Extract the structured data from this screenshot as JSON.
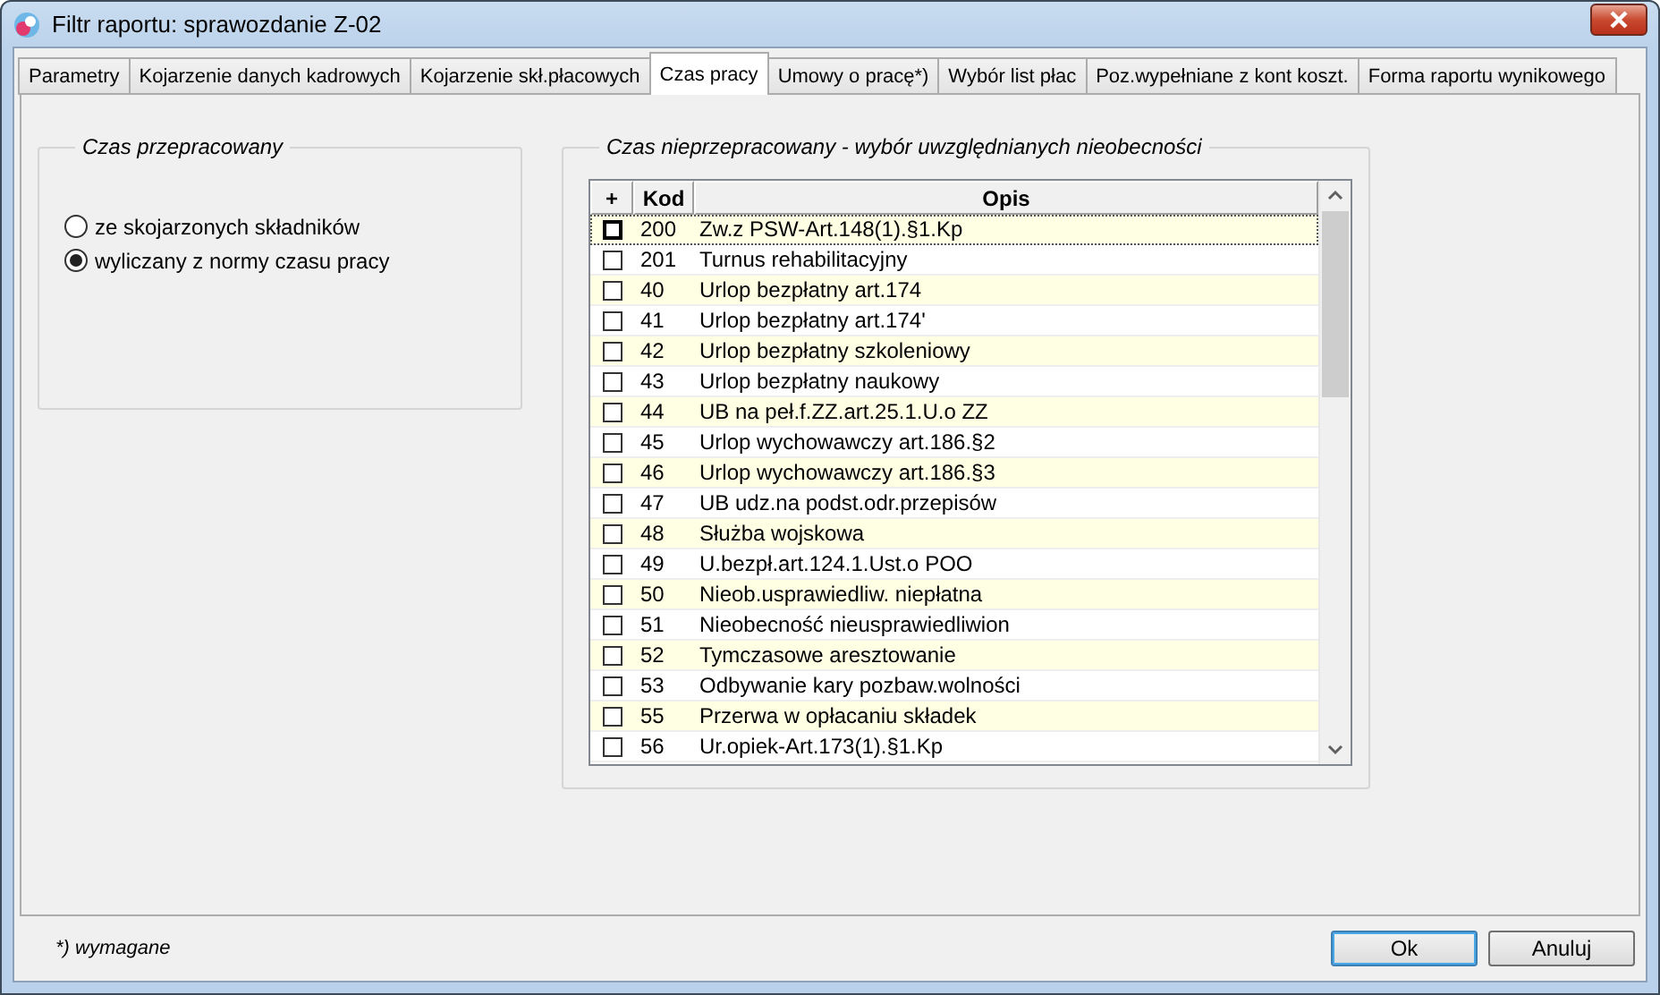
{
  "window": {
    "title": "Filtr raportu: sprawozdanie Z-02"
  },
  "tabs": [
    {
      "label": "Parametry",
      "selected": false
    },
    {
      "label": "Kojarzenie danych kadrowych",
      "selected": false
    },
    {
      "label": "Kojarzenie skł.płacowych",
      "selected": false
    },
    {
      "label": "Czas pracy",
      "selected": true
    },
    {
      "label": "Umowy o pracę*)",
      "selected": false
    },
    {
      "label": "Wybór list płac",
      "selected": false
    },
    {
      "label": "Poz.wypełniane z kont koszt.",
      "selected": false
    },
    {
      "label": "Forma raportu wynikowego",
      "selected": false
    }
  ],
  "worked_time": {
    "title": "Czas przepracowany",
    "options": [
      {
        "label": "ze skojarzonych składników",
        "selected": false
      },
      {
        "label": "wyliczany z normy czasu pracy",
        "selected": true
      }
    ]
  },
  "unworked_time": {
    "title": "Czas nieprzepracowany - wybór uwzględnianych nieobecności",
    "table": {
      "columns": [
        "+",
        "Kod",
        "Opis"
      ],
      "rows": [
        {
          "code": "200",
          "description": "Zw.z PSW-Art.148(1).§1.Kp",
          "checked": false,
          "focused": true
        },
        {
          "code": "201",
          "description": "Turnus rehabilitacyjny",
          "checked": false,
          "focused": false
        },
        {
          "code": "40",
          "description": "Urlop bezpłatny art.174",
          "checked": false,
          "focused": false
        },
        {
          "code": "41",
          "description": "Urlop bezpłatny art.174'",
          "checked": false,
          "focused": false
        },
        {
          "code": "42",
          "description": "Urlop bezpłatny szkoleniowy",
          "checked": false,
          "focused": false
        },
        {
          "code": "43",
          "description": "Urlop bezpłatny naukowy",
          "checked": false,
          "focused": false
        },
        {
          "code": "44",
          "description": "UB na peł.f.ZZ.art.25.1.U.o ZZ",
          "checked": false,
          "focused": false
        },
        {
          "code": "45",
          "description": "Urlop wychowawczy art.186.§2",
          "checked": false,
          "focused": false
        },
        {
          "code": "46",
          "description": "Urlop wychowawczy art.186.§3",
          "checked": false,
          "focused": false
        },
        {
          "code": "47",
          "description": "UB udz.na podst.odr.przepisów",
          "checked": false,
          "focused": false
        },
        {
          "code": "48",
          "description": "Służba wojskowa",
          "checked": false,
          "focused": false
        },
        {
          "code": "49",
          "description": "U.bezpł.art.124.1.Ust.o POO",
          "checked": false,
          "focused": false
        },
        {
          "code": "50",
          "description": "Nieob.usprawiedliw. niepłatna",
          "checked": false,
          "focused": false
        },
        {
          "code": "51",
          "description": "Nieobecność nieusprawiedliwion",
          "checked": false,
          "focused": false
        },
        {
          "code": "52",
          "description": "Tymczasowe aresztowanie",
          "checked": false,
          "focused": false
        },
        {
          "code": "53",
          "description": "Odbywanie kary pozbaw.wolności",
          "checked": false,
          "focused": false
        },
        {
          "code": "55",
          "description": "Przerwa w opłacaniu składek",
          "checked": false,
          "focused": false
        },
        {
          "code": "56",
          "description": "Ur.opiek-Art.173(1).§1.Kp",
          "checked": false,
          "focused": false
        }
      ]
    }
  },
  "footnote": "*) wymagane",
  "buttons": [
    {
      "label": "Ok",
      "default": true
    },
    {
      "label": "Anuluj",
      "default": false
    }
  ]
}
